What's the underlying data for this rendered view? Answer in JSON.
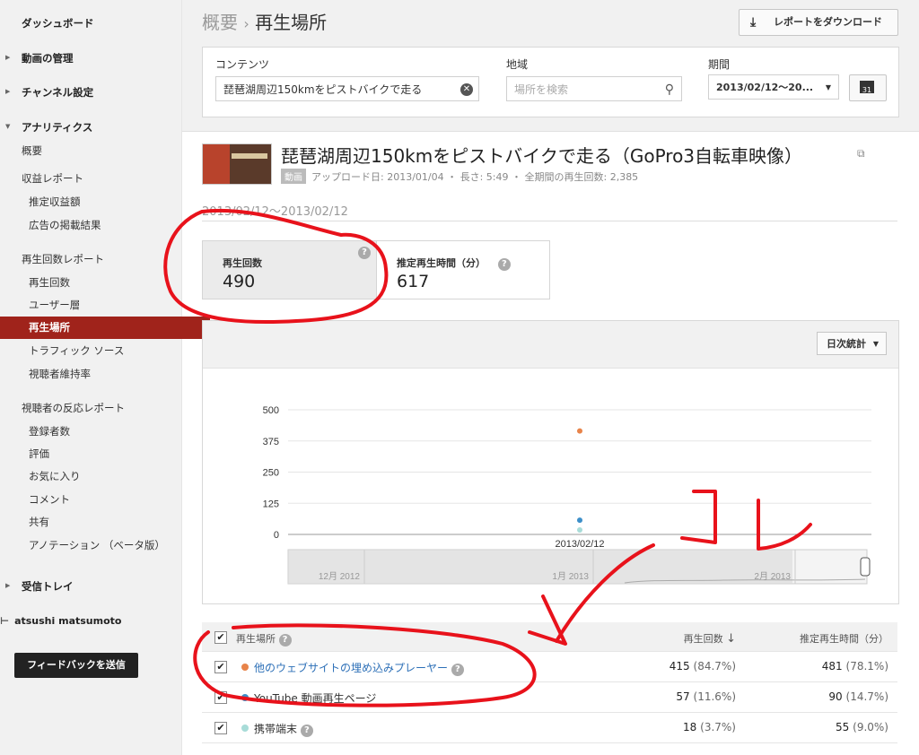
{
  "sidebar": {
    "dashboard": "ダッシュボード",
    "video_manager": "動画の管理",
    "channel_settings": "チャンネル設定",
    "analytics": "アナリティクス",
    "overview": "概要",
    "revenue_reports": "収益レポート",
    "estimated_earnings": "推定収益額",
    "ad_performance": "広告の掲載結果",
    "views_reports": "再生回数レポート",
    "views": "再生回数",
    "demographics": "ユーザー層",
    "playback_locations": "再生場所",
    "traffic_sources": "トラフィック ソース",
    "audience_retention": "視聴者維持率",
    "engagement_reports": "視聴者の反応レポート",
    "subscribers": "登録者数",
    "likes": "評価",
    "favorites": "お気に入り",
    "comments": "コメント",
    "sharing": "共有",
    "annotations": "アノテーション （ベータ版）",
    "inbox": "受信トレイ",
    "user_name": "atsushi matsumoto",
    "feedback_button": "フィードバックを送信"
  },
  "header": {
    "breadcrumb_parent": "概要",
    "breadcrumb_sep": "›",
    "breadcrumb_current": "再生場所",
    "download_button": "レポートをダウンロード"
  },
  "filters": {
    "content_label": "コンテンツ",
    "content_value": "琵琶湖周辺150kmをピストバイクで走る",
    "region_label": "地域",
    "region_placeholder": "場所を検索",
    "period_label": "期間",
    "period_value": "2013/02/12〜20..."
  },
  "video": {
    "title": "琵琶湖周辺150kmをピストバイクで走る（GoPro3自転車映像）",
    "type_badge": "動画",
    "meta": "アップロード日: 2013/01/04 ・ 長さ: 5:49 ・ 全期間の再生回数: 2,385"
  },
  "date_range": "2013/02/12〜2013/02/12",
  "metrics": [
    {
      "label": "再生回数",
      "value": "490"
    },
    {
      "label": "推定再生時間（分）",
      "value": "617"
    }
  ],
  "chart_controls": {
    "interval_button": "日次統計"
  },
  "chart_data": {
    "type": "scatter",
    "y_ticks": [
      "500",
      "375",
      "250",
      "125",
      "0"
    ],
    "ylim": [
      0,
      500
    ],
    "x_label_point": "2013/02/12",
    "series": [
      {
        "color": "#e8844a",
        "values": [
          415
        ]
      },
      {
        "color": "#3d8fc9",
        "values": [
          57
        ]
      },
      {
        "color": "#a8dcd8",
        "values": [
          18
        ]
      }
    ],
    "navigator_labels": [
      "12月 2012",
      "1月 2013",
      "2月 2013"
    ]
  },
  "table": {
    "col_source": "再生場所",
    "col_views": "再生回数",
    "col_watch_time": "推定再生時間（分）",
    "rows": [
      {
        "source": "他のウェブサイトの埋め込みプレーヤー",
        "views": "415",
        "views_pct": "(84.7%)",
        "watch": "481",
        "watch_pct": "(78.1%)",
        "color": "#e8844a"
      },
      {
        "source": "YouTube 動画再生ページ",
        "views": "57",
        "views_pct": "(11.6%)",
        "watch": "90",
        "watch_pct": "(14.7%)",
        "color": "#3d8fc9"
      },
      {
        "source": "携帯端末",
        "views": "18",
        "views_pct": "(3.7%)",
        "watch": "55",
        "watch_pct": "(9.0%)",
        "color": "#a8dcd8"
      }
    ]
  },
  "colors": {
    "active_nav": "#a0231b",
    "annotation_red": "#e8121b",
    "link_blue": "#2c6fb7"
  }
}
